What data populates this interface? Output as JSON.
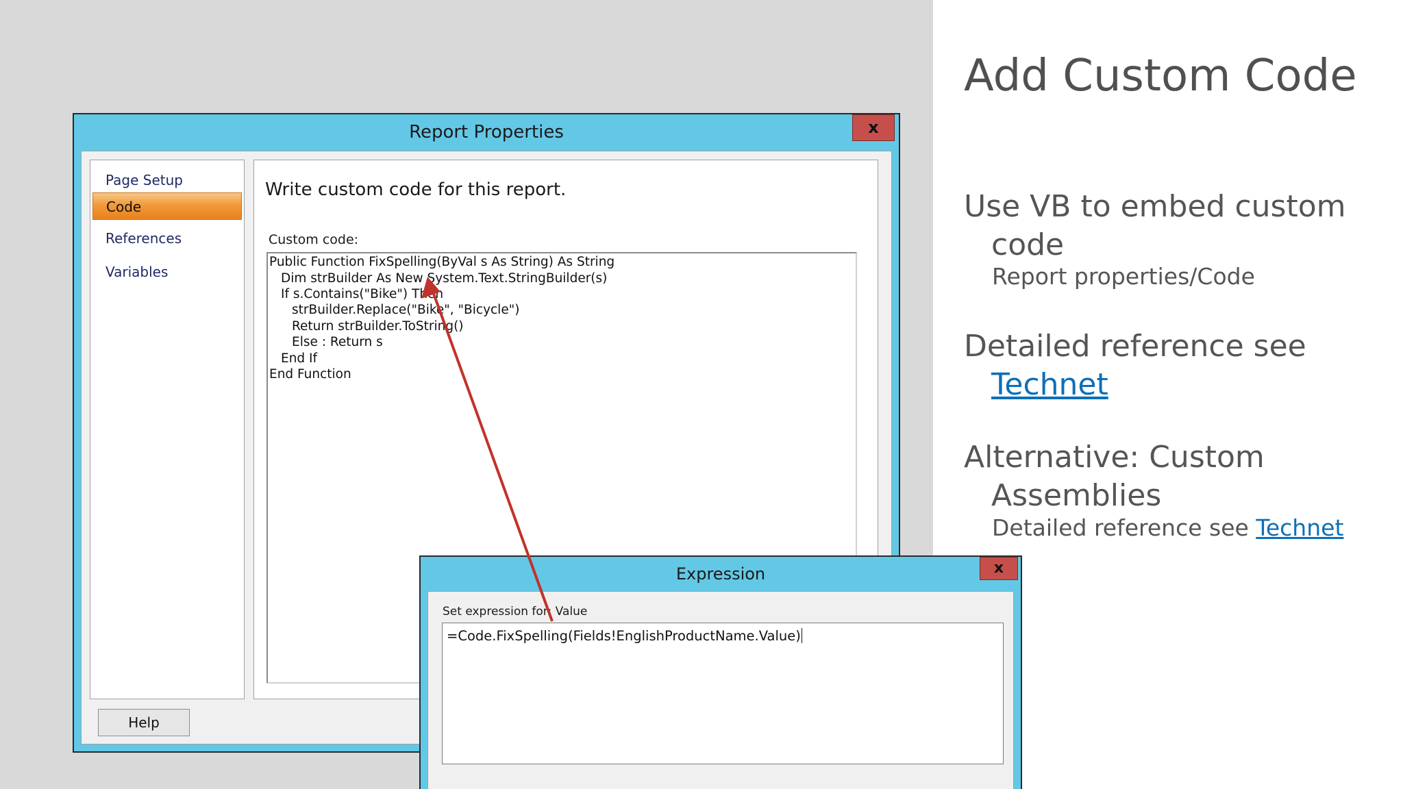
{
  "slide": {
    "title": "Add Custom Code",
    "bullets": [
      {
        "line1": "Use VB to embed custom",
        "line2": "code",
        "sub": "Report properties/Code"
      },
      {
        "line1": "Detailed reference see",
        "link": "Technet"
      },
      {
        "line1": "Alternative: Custom",
        "line2": "Assemblies",
        "sub_prefix": "Detailed reference see ",
        "sub_link": "Technet"
      }
    ]
  },
  "report_properties": {
    "title": "Report Properties",
    "close_label": "x",
    "nav_items": [
      "Page Setup",
      "Code",
      "References",
      "Variables"
    ],
    "selected_nav": "Code",
    "description": "Write custom code for this report.",
    "code_label": "Custom code:",
    "code_lines": [
      "Public Function FixSpelling(ByVal s As String) As String",
      "Dim strBuilder As New System.Text.StringBuilder(s)",
      "If s.Contains(\"Bike\") Then",
      "strBuilder.Replace(\"Bike\", \"Bicycle\")",
      "Return strBuilder.ToString()",
      "Else : Return s",
      "End If",
      "End Function"
    ],
    "help_label": "Help"
  },
  "expression_dialog": {
    "title": "Expression",
    "close_label": "x",
    "label": "Set expression for: Value",
    "value": "=Code.FixSpelling(Fields!EnglishProductName.Value)"
  },
  "colors": {
    "dialog_frame": "#63c8e6",
    "close_button": "#c64f4c",
    "selected_nav": "#f19a3a",
    "arrow": "#c0332b",
    "link": "#0d6fb8"
  }
}
